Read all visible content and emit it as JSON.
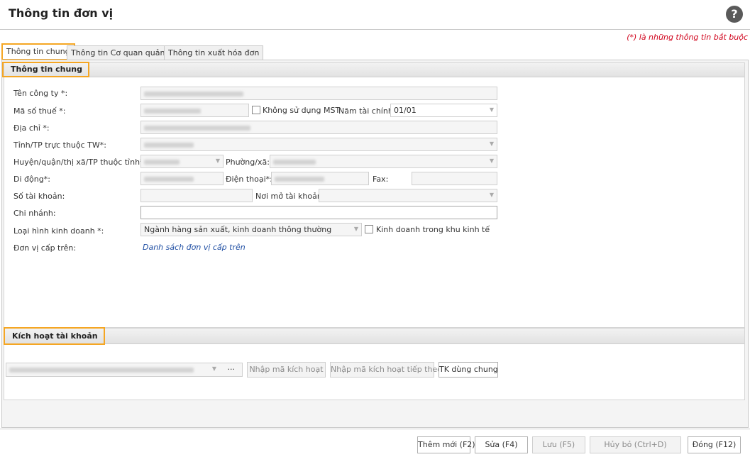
{
  "window": {
    "title": "Thông tin đơn vị",
    "help_icon": "?"
  },
  "required_note": "(*)  là những thông tin bắt buộc",
  "tabs": [
    {
      "label": "Thông tin chung",
      "active": true
    },
    {
      "label": "Thông tin Cơ quan quản lý",
      "active": false
    },
    {
      "label": "Thông tin xuất hóa đơn",
      "active": false
    }
  ],
  "general": {
    "section_title": "Thông tin chung",
    "company_name_label": "Tên công ty *:",
    "tax_code_label": "Mã số thuế *:",
    "no_tax_code_label": "Không sử dụng MST",
    "fiscal_year_label": "Năm tài chính:",
    "fiscal_year_value": "01/01",
    "address_label": "Địa chỉ *:",
    "province_label": "Tỉnh/TP trực thuộc TW*:",
    "district_label": "Huyện/quận/thị xã/TP thuộc tỉnh*:",
    "ward_label": "Phường/xã:",
    "mobile_label": "Di động*:",
    "phone_label": "Điện thoại*:",
    "fax_label": "Fax:",
    "bank_account_label": "Số tài khoản:",
    "bank_place_label": "Nơi mở tài khoản:",
    "branch_label": "Chi nhánh:",
    "business_type_label": "Loại hình kinh doanh *:",
    "business_type_value": "Ngành hàng sản xuất, kinh doanh thông thường",
    "economic_zone_label": "Kinh doanh trong khu kinh tế",
    "parent_unit_label": "Đơn vị cấp trên:",
    "parent_unit_link": "Danh sách đơn vị cấp trên"
  },
  "activation": {
    "section_title": "Kích hoạt tài khoản",
    "ellipsis": "···",
    "enter_code_button": "Nhập mã kích hoạt",
    "enter_next_code_button": "Nhập mã kích hoạt tiếp theo",
    "shared_account_button": "TK dùng chung"
  },
  "footer": {
    "add_button": "Thêm mới (F2)",
    "edit_button": "Sửa (F4)",
    "save_button": "Lưu (F5)",
    "cancel_button": "Hủy bỏ (Ctrl+D)",
    "close_button": "Đóng (F12)"
  },
  "colors": {
    "accent_highlight": "#f5a623",
    "required_text": "#d0021b",
    "link": "#1f4ea3"
  }
}
